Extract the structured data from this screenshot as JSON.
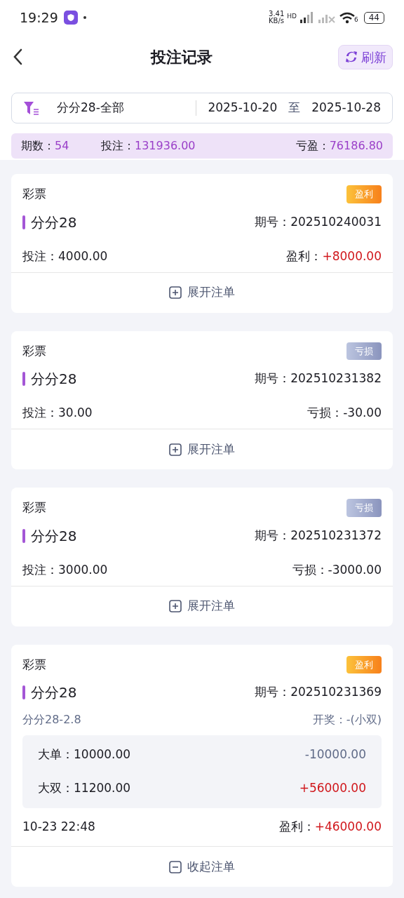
{
  "status_bar": {
    "time": "19:29",
    "speed_value": "3.41",
    "speed_unit": "KB/s",
    "network": "HD",
    "wifi_badge": "6",
    "battery": "44"
  },
  "header": {
    "title": "投注记录",
    "refresh_label": "刷新"
  },
  "filter": {
    "game": "分分28-全部",
    "start_date": "2025-10-20",
    "separator": "至",
    "end_date": "2025-10-28"
  },
  "summary": [
    {
      "label": "期数：",
      "value": "54"
    },
    {
      "label": "投注：",
      "value": "131936.00"
    },
    {
      "label": "亏盈：",
      "value": "76186.80"
    }
  ],
  "records": [
    {
      "category": "彩票",
      "result": {
        "kind": "profit",
        "label": "盈利"
      },
      "game": "分分28",
      "issue_label": "期号：",
      "issue": "202510240031",
      "bet_label": "投注：",
      "bet": "4000.00",
      "pl_label": "盈利：",
      "pl": "+8000.00",
      "expanded": false,
      "toggle": "展开注单"
    },
    {
      "category": "彩票",
      "result": {
        "kind": "loss",
        "label": "亏损"
      },
      "game": "分分28",
      "issue_label": "期号：",
      "issue": "202510231382",
      "bet_label": "投注：",
      "bet": "30.00",
      "pl_label": "亏损：",
      "pl": "-30.00",
      "expanded": false,
      "toggle": "展开注单"
    },
    {
      "category": "彩票",
      "result": {
        "kind": "loss",
        "label": "亏损"
      },
      "game": "分分28",
      "issue_label": "期号：",
      "issue": "202510231372",
      "bet_label": "投注：",
      "bet": "3000.00",
      "pl_label": "亏损：",
      "pl": "-3000.00",
      "expanded": false,
      "toggle": "展开注单"
    },
    {
      "category": "彩票",
      "result": {
        "kind": "profit",
        "label": "盈利"
      },
      "game": "分分28",
      "issue_label": "期号：",
      "issue": "202510231369",
      "play": "分分28-2.8",
      "draw": "开奖：-(小双)",
      "bets": [
        {
          "label": "大单：",
          "amount": "10000.00",
          "result": "-10000.00",
          "kind": "loss"
        },
        {
          "label": "大双：",
          "amount": "11200.00",
          "result": "+56000.00",
          "kind": "profit"
        }
      ],
      "time": "10-23 22:48",
      "pl_label": "盈利：",
      "pl": "+46000.00",
      "expanded": true,
      "toggle": "收起注单"
    }
  ]
}
